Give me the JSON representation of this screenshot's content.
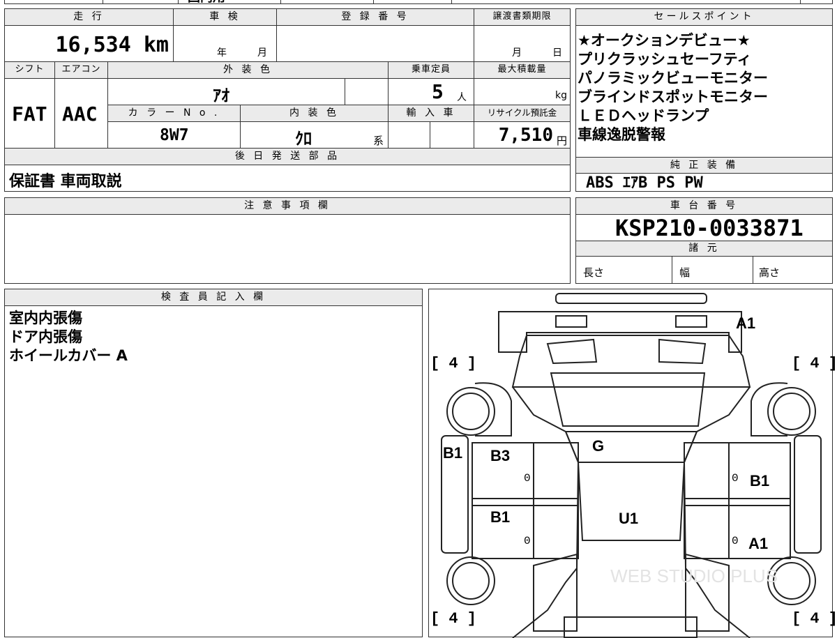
{
  "top_strip": {
    "partial_text": "国内用"
  },
  "headers": {
    "mileage": "走 行",
    "inspection": "車 検",
    "registration": "登 録 番 号",
    "transfer_deadline": "譲渡書類期限",
    "shift": "シフト",
    "aircon": "エアコン",
    "exterior_color": "外 装 色",
    "capacity": "乗車定員",
    "max_load": "最大積載量",
    "color_no": "カ ラ ー N o .",
    "interior_color": "内 装 色",
    "import": "輸 入 車",
    "recycle": "リサイクル預託金",
    "later_parts": "後 日 発 送 部 品",
    "sales_points": "セールスポイント",
    "standard_equipment": "純 正 装 備",
    "notes": "注 意 事 項 欄",
    "chassis_no": "車 台 番 号",
    "specs": "諸 元",
    "inspector": "検 査 員 記 入 欄"
  },
  "values": {
    "mileage": "16,534 km",
    "year_unit": "年",
    "month_unit": "月",
    "deadline_month": "月",
    "deadline_day": "日",
    "shift": "FAT",
    "aircon": "AAC",
    "exterior_color": "ｱｵ",
    "capacity": "5",
    "capacity_unit": "人",
    "load_unit": "kg",
    "color_no": "8W7",
    "interior_color": "ｸﾛ",
    "interior_suffix": "系",
    "recycle_amount": "7,510",
    "recycle_unit": "円",
    "later_parts": "保証書 車両取説",
    "chassis_no": "KSP210-0033871",
    "length_label": "長さ",
    "width_label": "幅",
    "height_label": "高さ"
  },
  "sales_points": [
    "★オークションデビュー★",
    "プリクラッシュセーフティ",
    "パノラミックビューモニター",
    "ブラインドスポットモニター",
    "ＬＥＤヘッドランプ",
    "車線逸脱警報"
  ],
  "standard_equipment": "ABS ｴｱB PS PW",
  "inspector_notes": [
    "室内内張傷",
    "ドア内張傷",
    "ホイールカバー A"
  ],
  "diagram": {
    "codes": {
      "front_bumper": "A1",
      "windshield": "G",
      "roof": "U1",
      "left_front_fender": "B1",
      "left_front_door": "B3",
      "left_rear_door": "B1",
      "right_front_door": "B1",
      "right_rear_door": "A1"
    },
    "tire_values": {
      "front_left": "4",
      "front_right": "4",
      "rear_left": "4",
      "rear_right": "4"
    },
    "door_zero": "0",
    "watermark": "WEB STUDIO PLUS"
  }
}
